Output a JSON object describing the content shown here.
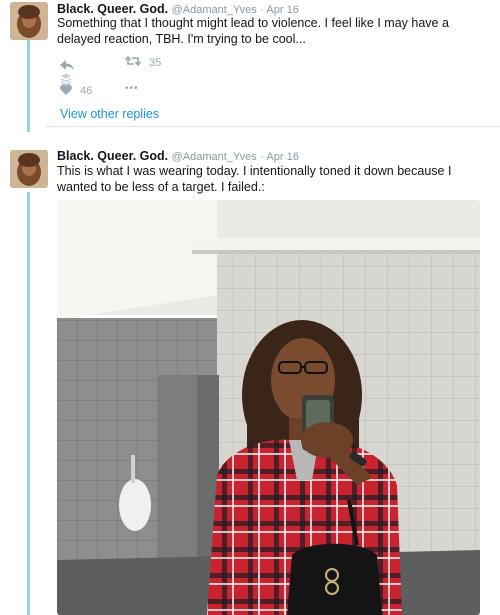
{
  "tweets": [
    {
      "name": "Black. Queer. God.",
      "handle": "@Adamant_Yves",
      "date": "Apr 16",
      "text": "Something that I thought might lead to violence. I feel like I may have a delayed reaction, TBH. I'm trying to be cool...",
      "retweets": "35",
      "likes": "46",
      "more": "•••"
    },
    {
      "name": "Black. Queer. God.",
      "handle": "@Adamant_Yves",
      "date": "Apr 16",
      "text": "This is what I was wearing today. I intentionally toned it down because I wanted to be less of a target. I failed.:"
    }
  ],
  "view_other_replies": "View other replies",
  "icons": {
    "reply": "reply-icon",
    "retweet": "retweet-icon",
    "like": "heart-icon",
    "more": "more-icon",
    "stack": "stack-icon"
  },
  "colors": {
    "thread_line": "#8fd3f0",
    "link": "#1b95e0",
    "meta": "#8899a6",
    "icon": "#9aa8b2",
    "plaid_red": "#c8232f"
  }
}
